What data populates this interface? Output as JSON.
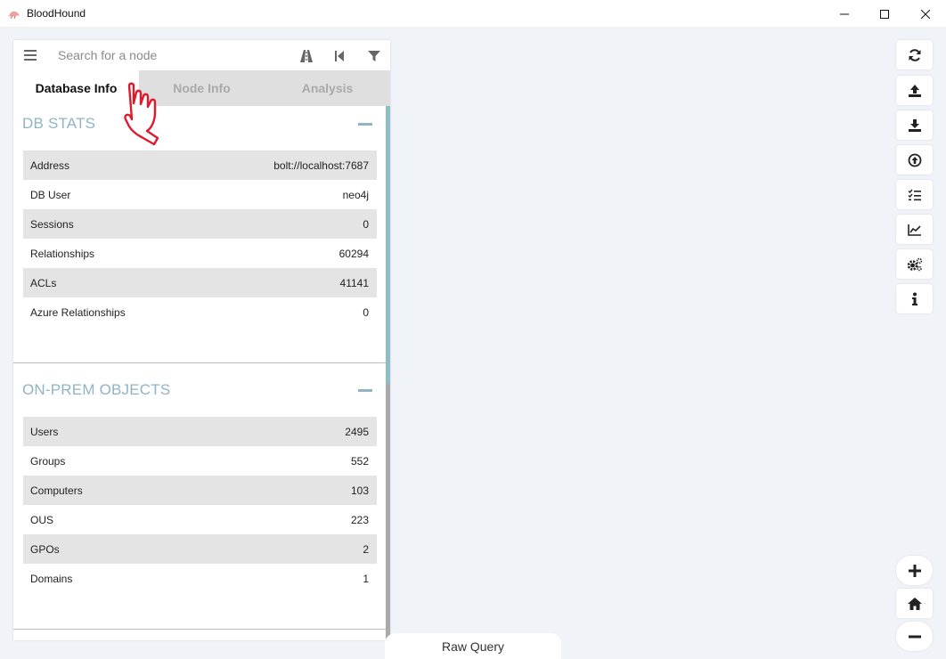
{
  "window": {
    "title": "BloodHound",
    "icon": "bloodhound-icon",
    "controls": [
      "minimize-icon",
      "maximize-icon",
      "close-icon"
    ]
  },
  "search": {
    "placeholder": "Search for a node",
    "icons": [
      "menu-icon",
      "pathfinding-icon",
      "back-icon",
      "filter-icon"
    ]
  },
  "tabs": [
    {
      "label": "Database Info",
      "active": true
    },
    {
      "label": "Node Info",
      "active": false
    },
    {
      "label": "Analysis",
      "active": false
    }
  ],
  "db_stats": {
    "title": "DB STATS",
    "rows": [
      {
        "label": "Address",
        "value": "bolt://localhost:7687"
      },
      {
        "label": "DB User",
        "value": "neo4j"
      },
      {
        "label": "Sessions",
        "value": "0"
      },
      {
        "label": "Relationships",
        "value": "60294"
      },
      {
        "label": "ACLs",
        "value": "41141"
      },
      {
        "label": "Azure Relationships",
        "value": "0"
      }
    ]
  },
  "on_prem": {
    "title": "ON-PREM OBJECTS",
    "rows": [
      {
        "label": "Users",
        "value": "2495"
      },
      {
        "label": "Groups",
        "value": "552"
      },
      {
        "label": "Computers",
        "value": "103"
      },
      {
        "label": "OUS",
        "value": "223"
      },
      {
        "label": "GPOs",
        "value": "2"
      },
      {
        "label": "Domains",
        "value": "1"
      }
    ]
  },
  "toolbar_right": [
    "refresh-icon",
    "upload-icon",
    "download-icon",
    "import-icon",
    "queries-icon",
    "chart-icon",
    "settings-icon",
    "info-icon"
  ],
  "zoom_controls": [
    "zoom-in-icon",
    "home-icon",
    "zoom-out-icon"
  ],
  "raw_query": {
    "label": "Raw Query"
  },
  "colors": {
    "accent": "#8fb4c4",
    "cursor": "#e0192d",
    "background": "#f0f3f8",
    "row_shade": "#e4e4e4",
    "scroll_teal": "#8bbfc4"
  }
}
